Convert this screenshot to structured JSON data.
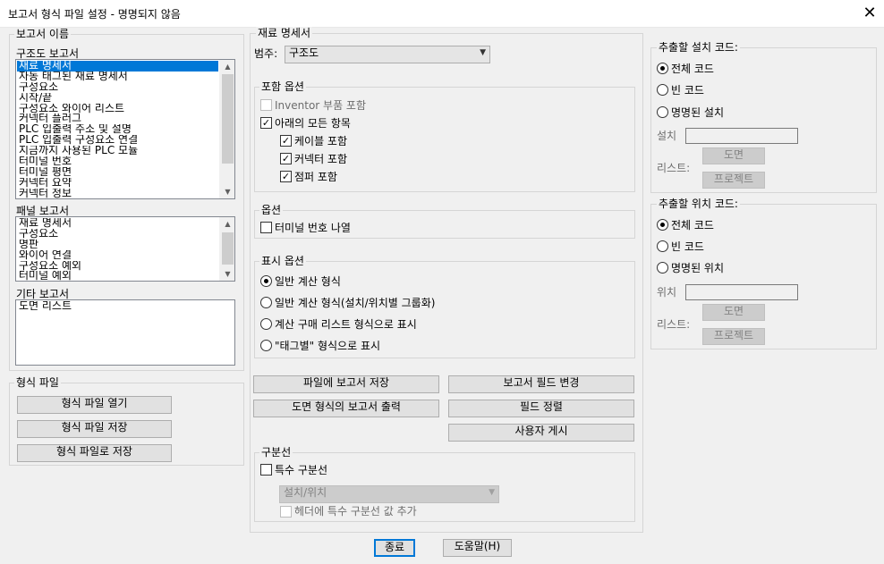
{
  "window": {
    "title": "보고서 형식 파일 설정 - 명명되지 않음"
  },
  "report_names": {
    "caption": "보고서 이름",
    "schematic": {
      "label": "구조도 보고서",
      "items": [
        "재료 명세서",
        "자동 태그된 재료 명세서",
        "구성요소",
        "시작/끝",
        "구성요소 와이어 리스트",
        "커넥터 플러그",
        "PLC 입출력 주소 및 설명",
        "PLC 입출력 구성요소 연결",
        "지금까지 사용된 PLC 모듈",
        "터미널 번호",
        "터미널 평면",
        "커넥터 요약",
        "커넥터 정보"
      ],
      "selected_index": 0
    },
    "panel": {
      "label": "패널 보고서",
      "items": [
        "재료 명세서",
        "구성요소",
        "명판",
        "와이어 연결",
        "구성요소 예외",
        "터미널 예외"
      ]
    },
    "other": {
      "label": "기타 보고서",
      "items": [
        "도면 리스트"
      ]
    }
  },
  "format_file": {
    "caption": "형식 파일",
    "open_label": "형식 파일 열기",
    "save_label": "형식 파일 저장",
    "save_as_label": "형식 파일로 저장"
  },
  "bom": {
    "caption": "재료 명세서",
    "category_label": "범주:",
    "category_value": "구조도"
  },
  "include_options": {
    "caption": "포함 옵션",
    "inventor_parts": {
      "label": "Inventor 부품 포함",
      "checked": false,
      "enabled": false
    },
    "all_below": {
      "label": "아래의 모든 항목",
      "checked": true
    },
    "cable": {
      "label": "케이블 포함",
      "checked": true
    },
    "connector": {
      "label": "커넥터 포함",
      "checked": true
    },
    "jumper": {
      "label": "점퍼 포함",
      "checked": true
    }
  },
  "options": {
    "caption": "옵션",
    "list_terminal_numbers": {
      "label": "터미널 번호 나열",
      "checked": false
    }
  },
  "display_options": {
    "caption": "표시 옵션",
    "selected_index": 0,
    "items": [
      "일반 계산 형식",
      "일반 계산 형식(설치/위치별 그룹화)",
      "계산 구매 리스트 형식으로 표시",
      "\"태그별\" 형식으로 표시"
    ]
  },
  "actions": {
    "save_report_to_file": "파일에 보고서 저장",
    "change_report_fields": "보고서 필드 변경",
    "output_report_drawing": "도면 형식의 보고서 출력",
    "sort_fields": "필드 정렬",
    "user_post": "사용자 게시"
  },
  "break": {
    "caption": "구분선",
    "special_break": {
      "label": "특수 구분선",
      "checked": false
    },
    "combo_value": "설치/위치",
    "add_header_break": {
      "label": "헤더에 특수 구분선 값 추가",
      "checked": false
    }
  },
  "install_codes": {
    "caption": "추출할 설치 코드:",
    "selected_index": 0,
    "items": [
      "전체 코드",
      "빈 코드",
      "명명된 설치"
    ],
    "field_label": "설치",
    "list_label": "리스트:",
    "drawing_btn": "도면",
    "project_btn": "프로젝트"
  },
  "location_codes": {
    "caption": "추출할 위치 코드:",
    "selected_index": 0,
    "items": [
      "전체 코드",
      "빈 코드",
      "명명된 위치"
    ],
    "field_label": "위치",
    "list_label": "리스트:",
    "drawing_btn": "도면",
    "project_btn": "프로젝트"
  },
  "footer": {
    "close_label": "종료",
    "help_label": "도움말(H)"
  }
}
